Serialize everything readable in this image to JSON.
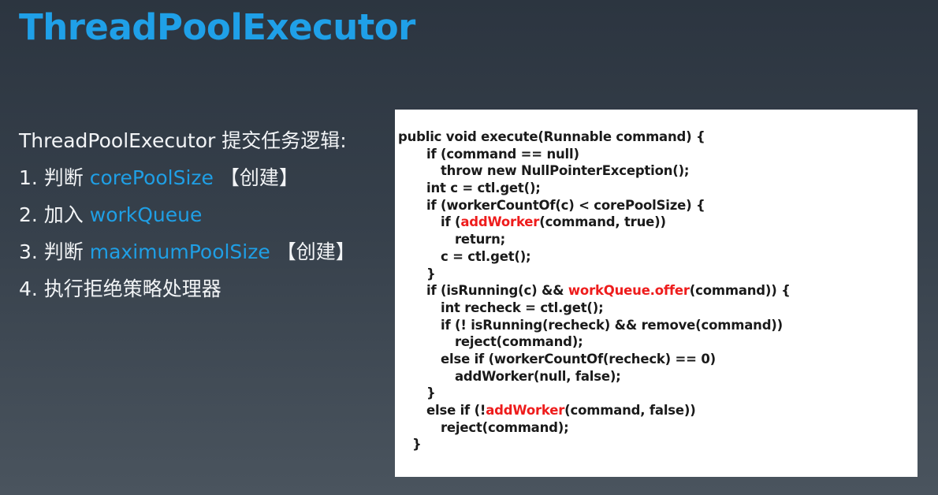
{
  "title": "ThreadPoolExecutor",
  "points": [
    {
      "pre": "ThreadPoolExecutor 提交任务逻辑:",
      "hl": "",
      "post": ""
    },
    {
      "pre": "1. 判断 ",
      "hl": "corePoolSize",
      "post": " 【创建】"
    },
    {
      "pre": "2. 加入 ",
      "hl": "workQueue",
      "post": ""
    },
    {
      "pre": "3. 判断 ",
      "hl": "maximumPoolSize",
      "post": " 【创建】"
    },
    {
      "pre": "4. 执行拒绝策略处理器",
      "hl": "",
      "post": ""
    }
  ],
  "code": [
    {
      "indent": 0,
      "segments": [
        {
          "t": "public void execute(Runnable command) {"
        }
      ]
    },
    {
      "indent": 2,
      "segments": [
        {
          "t": "if (command == null)"
        }
      ]
    },
    {
      "indent": 3,
      "segments": [
        {
          "t": "throw new NullPointerException();"
        }
      ]
    },
    {
      "indent": 2,
      "segments": [
        {
          "t": "int c = ctl.get();"
        }
      ]
    },
    {
      "indent": 2,
      "segments": [
        {
          "t": "if (workerCountOf(c) < corePoolSize) {"
        }
      ]
    },
    {
      "indent": 3,
      "segments": [
        {
          "t": "if ("
        },
        {
          "t": "addWorker",
          "red": true
        },
        {
          "t": "(command, true))"
        }
      ]
    },
    {
      "indent": 4,
      "segments": [
        {
          "t": "return;"
        }
      ]
    },
    {
      "indent": 3,
      "segments": [
        {
          "t": "c = ctl.get();"
        }
      ]
    },
    {
      "indent": 2,
      "segments": [
        {
          "t": "}"
        }
      ]
    },
    {
      "indent": 2,
      "segments": [
        {
          "t": "if (isRunning(c) && "
        },
        {
          "t": "workQueue.offer",
          "red": true
        },
        {
          "t": "(command)) {"
        }
      ]
    },
    {
      "indent": 3,
      "segments": [
        {
          "t": "int recheck = ctl.get();"
        }
      ]
    },
    {
      "indent": 3,
      "segments": [
        {
          "t": "if (! isRunning(recheck) && remove(command))"
        }
      ]
    },
    {
      "indent": 4,
      "segments": [
        {
          "t": "reject(command);"
        }
      ]
    },
    {
      "indent": 3,
      "segments": [
        {
          "t": "else if (workerCountOf(recheck) == 0)"
        }
      ]
    },
    {
      "indent": 4,
      "segments": [
        {
          "t": "addWorker(null, false);"
        }
      ]
    },
    {
      "indent": 2,
      "segments": [
        {
          "t": "}"
        }
      ]
    },
    {
      "indent": 2,
      "segments": [
        {
          "t": "else if (!"
        },
        {
          "t": "addWorker",
          "red": true
        },
        {
          "t": "(command, false))"
        }
      ]
    },
    {
      "indent": 3,
      "segments": [
        {
          "t": "reject(command);"
        }
      ]
    },
    {
      "indent": 1,
      "segments": [
        {
          "t": "}"
        }
      ]
    }
  ]
}
